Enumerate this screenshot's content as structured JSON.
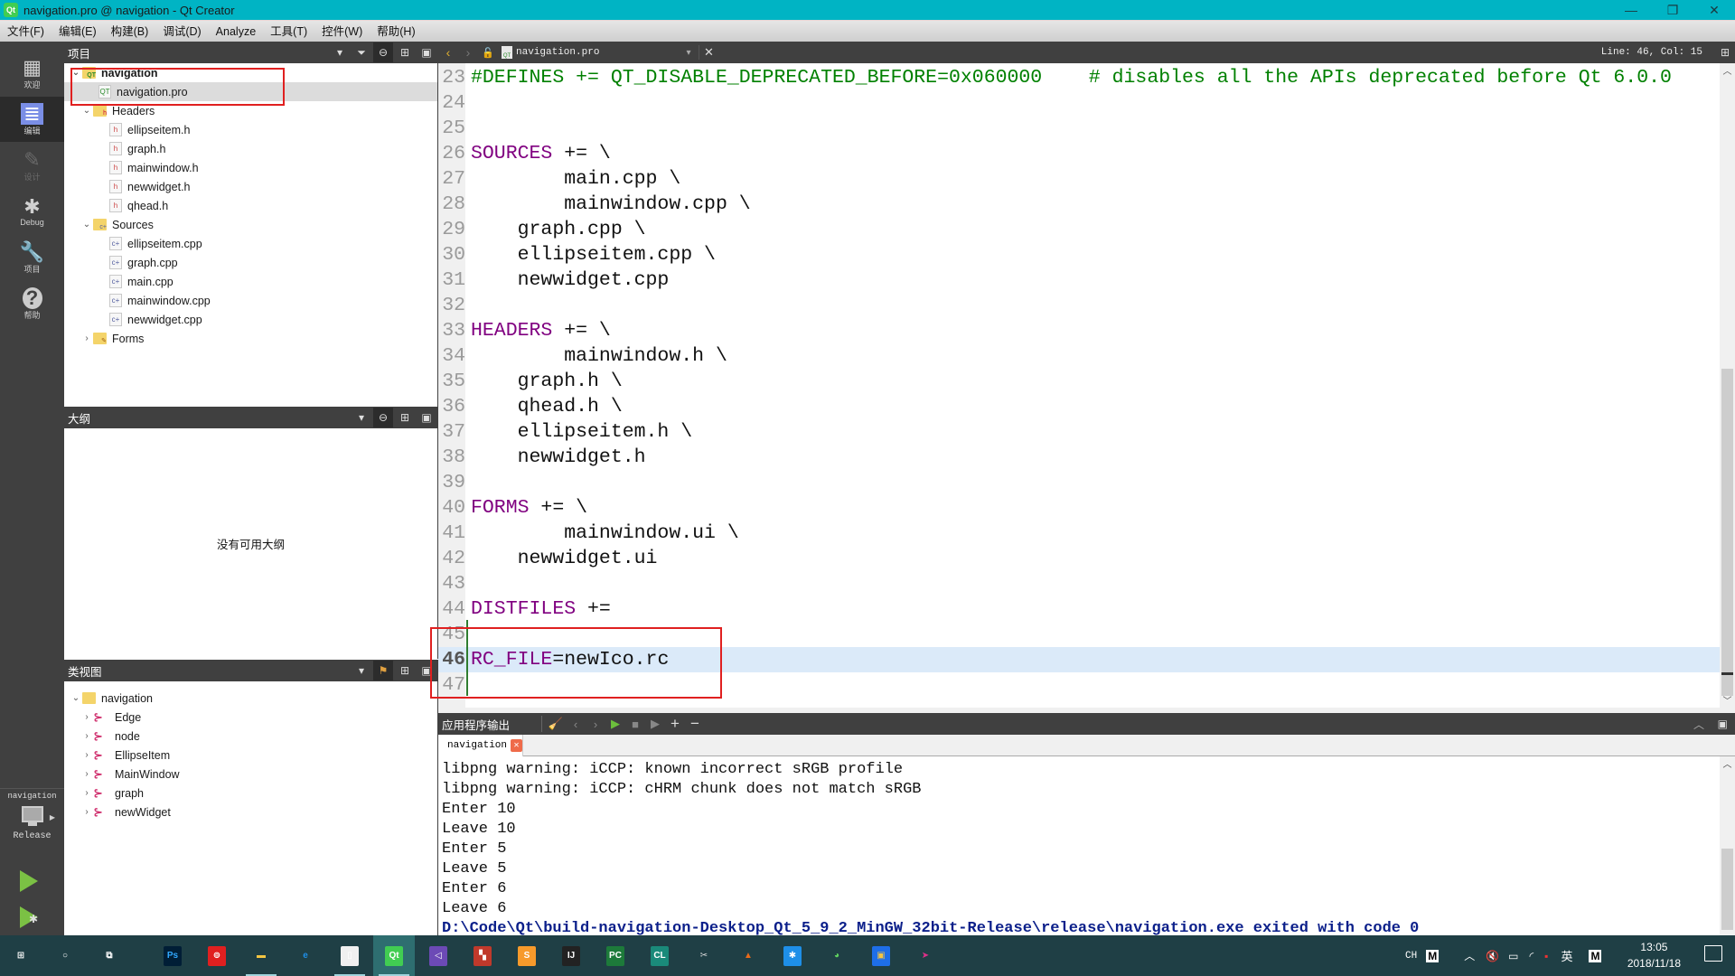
{
  "window": {
    "title": "navigation.pro @ navigation - Qt Creator",
    "controls": {
      "minimize": "—",
      "restore": "❐",
      "close": "✕"
    }
  },
  "menubar": [
    "文件(F)",
    "编辑(E)",
    "构建(B)",
    "调试(D)",
    "Analyze",
    "工具(T)",
    "控件(W)",
    "帮助(H)"
  ],
  "modes": [
    {
      "label": "欢迎",
      "icon": "grid-icon"
    },
    {
      "label": "编辑",
      "icon": "edit-document-icon",
      "active": true
    },
    {
      "label": "设计",
      "icon": "pencil-icon",
      "disabled": true
    },
    {
      "label": "Debug",
      "icon": "bug-icon"
    },
    {
      "label": "项目",
      "icon": "wrench-icon"
    },
    {
      "label": "帮助",
      "icon": "help-icon"
    }
  ],
  "kit": {
    "project": "navigation",
    "config": "Release"
  },
  "projects_pane": {
    "title": "项目",
    "root": "navigation",
    "pro_file": "navigation.pro",
    "headers_label": "Headers",
    "headers": [
      "ellipseitem.h",
      "graph.h",
      "mainwindow.h",
      "newwidget.h",
      "qhead.h"
    ],
    "sources_label": "Sources",
    "sources": [
      "ellipseitem.cpp",
      "graph.cpp",
      "main.cpp",
      "mainwindow.cpp",
      "newwidget.cpp"
    ],
    "forms_label": "Forms"
  },
  "outline_pane": {
    "title": "大纲",
    "empty_text": "没有可用大纲"
  },
  "class_pane": {
    "title": "类视图",
    "root": "navigation",
    "classes": [
      "Edge",
      "node",
      "EllipseItem",
      "MainWindow",
      "graph",
      "newWidget"
    ]
  },
  "editor": {
    "file_name": "navigation.pro",
    "cursor_position": "Line: 46, Col: 15",
    "current_line": 46,
    "lines": [
      {
        "n": "23",
        "parts": [
          {
            "t": "#DEFINES += QT_DISABLE_DEPRECATED_BEFORE=0x060000    # disables all the APIs deprecated before Qt 6.0.0",
            "c": "cm"
          }
        ]
      },
      {
        "n": "24",
        "parts": []
      },
      {
        "n": "25",
        "parts": []
      },
      {
        "n": "26",
        "parts": [
          {
            "t": "SOURCES",
            "c": "kw"
          },
          {
            "t": " += \\",
            "c": ""
          }
        ]
      },
      {
        "n": "27",
        "parts": [
          {
            "t": "        main.cpp \\",
            "c": ""
          }
        ]
      },
      {
        "n": "28",
        "parts": [
          {
            "t": "        mainwindow.cpp \\",
            "c": ""
          }
        ]
      },
      {
        "n": "29",
        "parts": [
          {
            "t": "    graph.cpp \\",
            "c": ""
          }
        ]
      },
      {
        "n": "30",
        "parts": [
          {
            "t": "    ellipseitem.cpp \\",
            "c": ""
          }
        ]
      },
      {
        "n": "31",
        "parts": [
          {
            "t": "    newwidget.cpp",
            "c": ""
          }
        ]
      },
      {
        "n": "32",
        "parts": []
      },
      {
        "n": "33",
        "parts": [
          {
            "t": "HEADERS",
            "c": "kw"
          },
          {
            "t": " += \\",
            "c": ""
          }
        ]
      },
      {
        "n": "34",
        "parts": [
          {
            "t": "        mainwindow.h \\",
            "c": ""
          }
        ]
      },
      {
        "n": "35",
        "parts": [
          {
            "t": "    graph.h \\",
            "c": ""
          }
        ]
      },
      {
        "n": "36",
        "parts": [
          {
            "t": "    qhead.h \\",
            "c": ""
          }
        ]
      },
      {
        "n": "37",
        "parts": [
          {
            "t": "    ellipseitem.h \\",
            "c": ""
          }
        ]
      },
      {
        "n": "38",
        "parts": [
          {
            "t": "    newwidget.h",
            "c": ""
          }
        ]
      },
      {
        "n": "39",
        "parts": []
      },
      {
        "n": "40",
        "parts": [
          {
            "t": "FORMS",
            "c": "kw"
          },
          {
            "t": " += \\",
            "c": ""
          }
        ]
      },
      {
        "n": "41",
        "parts": [
          {
            "t": "        mainwindow.ui \\",
            "c": ""
          }
        ]
      },
      {
        "n": "42",
        "parts": [
          {
            "t": "    newwidget.ui",
            "c": ""
          }
        ]
      },
      {
        "n": "43",
        "parts": []
      },
      {
        "n": "44",
        "parts": [
          {
            "t": "DISTFILES",
            "c": "kw"
          },
          {
            "t": " +=",
            "c": ""
          }
        ]
      },
      {
        "n": "45",
        "parts": []
      },
      {
        "n": "46",
        "parts": [
          {
            "t": "RC_FILE",
            "c": "kw"
          },
          {
            "t": "=newIco.rc",
            "c": ""
          }
        ]
      },
      {
        "n": "47",
        "parts": []
      }
    ]
  },
  "output_pane": {
    "title": "应用程序输出",
    "tab": "navigation",
    "lines": [
      "libpng warning: iCCP: known incorrect sRGB profile",
      "libpng warning: iCCP: cHRM chunk does not match sRGB",
      "Enter 10",
      "Leave 10",
      "Enter 5",
      "Leave 5",
      "Enter 6",
      "Leave 6"
    ],
    "exit_line": "D:\\Code\\Qt\\build-navigation-Desktop_Qt_5_9_2_MinGW_32bit-Release\\release\\navigation.exe exited with code 0"
  },
  "taskbar": {
    "apps": [
      "start",
      "search",
      "task-view",
      "photoshop",
      "netease-music",
      "file-explorer",
      "edge",
      "notepad",
      "qt-creator",
      "visual-studio",
      "app-grid",
      "sublime-text",
      "intellij-idea",
      "pycharm",
      "clion",
      "tools",
      "matlab",
      "app-star",
      "wechat",
      "app-blue",
      "app-pink"
    ],
    "tray": {
      "lang": "CH",
      "ime": "英",
      "time": "13:05",
      "date": "2018/11/18"
    }
  }
}
